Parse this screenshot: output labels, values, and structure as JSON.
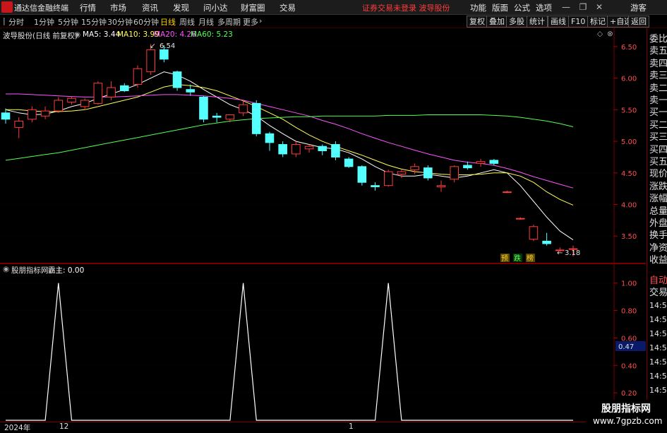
{
  "app": {
    "title": "通达信金融终端"
  },
  "menu": {
    "items": [
      "行情",
      "市场",
      "资讯",
      "发现",
      "问小达",
      "财富圈",
      "交易"
    ],
    "notice": "证券交易未登录  波导股份",
    "right_items": [
      "功能",
      "版面",
      "公式",
      "选项"
    ],
    "user": "游客",
    "r_badge": "R"
  },
  "toolbar": {
    "timeframes": [
      "分时",
      "1分钟",
      "5分钟",
      "15分钟",
      "30分钟",
      "60分钟",
      "日线",
      "周线",
      "月线",
      "多周期",
      "更多"
    ],
    "active": "日线",
    "right_buttons": [
      "复权",
      "叠加",
      "多股",
      "统计",
      "画线",
      "F10",
      "标记",
      "+自选",
      "返回"
    ]
  },
  "main_chart": {
    "stock_label": "波导股份(日线 前复权)",
    "ma": [
      {
        "label": "MA5: 3.44",
        "color": "#ffffff"
      },
      {
        "label": "MA10: 3.99",
        "color": "#ffff55"
      },
      {
        "label": "MA20: 4.26",
        "color": "#ff55ff"
      },
      {
        "label": "MA60: 5.23",
        "color": "#55ff55"
      }
    ],
    "high_label": "6.54",
    "low_label": "3.18",
    "signals": [
      "预",
      "跌",
      "榜"
    ],
    "y_ticks": [
      "6.50",
      "6.00",
      "5.50",
      "5.00",
      "4.50",
      "4.00",
      "3.50"
    ]
  },
  "sub_chart": {
    "indicator_label": "股朋指标网",
    "series_label": "霸主: 0.00",
    "y_ticks": [
      "1.00",
      "0.80",
      "0.60",
      "0.40",
      "0.20"
    ],
    "current_value": "0.47"
  },
  "right_panel": {
    "items": [
      "委比",
      "卖五",
      "卖四",
      "卖三",
      "卖二",
      "卖一",
      "买一",
      "买二",
      "买三",
      "买四",
      "买五",
      "现价",
      "涨跌",
      "涨幅",
      "总量",
      "外盘",
      "换手",
      "净资",
      "收益"
    ],
    "items2": [
      "自动",
      "交易"
    ],
    "times": [
      "14:56",
      "14:56",
      "14:56",
      "14:56",
      "14:56",
      "14:56",
      "14:56",
      "14:56"
    ]
  },
  "bottom": {
    "year": "2024年",
    "labels": [
      "12",
      "1"
    ]
  },
  "watermark": {
    "name": "股朋指标网",
    "url": "www.7gpzb.com"
  },
  "chart_data": {
    "type": "candlestick",
    "ylim": [
      3.1,
      6.7
    ],
    "candles": [
      [
        5.45,
        5.52,
        5.28,
        5.35
      ],
      [
        5.22,
        5.38,
        5.05,
        5.32
      ],
      [
        5.35,
        5.55,
        5.3,
        5.5
      ],
      [
        5.4,
        5.55,
        5.35,
        5.48
      ],
      [
        5.48,
        5.7,
        5.45,
        5.65
      ],
      [
        5.62,
        5.7,
        5.58,
        5.68
      ],
      [
        5.55,
        5.68,
        5.5,
        5.65
      ],
      [
        5.6,
        5.95,
        5.58,
        5.92
      ],
      [
        5.7,
        5.95,
        5.65,
        5.85
      ],
      [
        5.88,
        5.92,
        5.78,
        5.8
      ],
      [
        5.9,
        6.2,
        5.85,
        6.15
      ],
      [
        6.1,
        6.54,
        6.05,
        6.45
      ],
      [
        6.45,
        6.52,
        6.25,
        6.3
      ],
      [
        6.1,
        6.12,
        5.8,
        5.85
      ],
      [
        5.82,
        5.9,
        5.72,
        5.78
      ],
      [
        5.7,
        5.72,
        5.3,
        5.35
      ],
      [
        5.4,
        5.45,
        5.3,
        5.38
      ],
      [
        5.35,
        5.4,
        5.3,
        5.42
      ],
      [
        5.45,
        5.65,
        5.4,
        5.58
      ],
      [
        5.6,
        5.65,
        5.08,
        5.12
      ],
      [
        5.12,
        5.15,
        4.85,
        4.98
      ],
      [
        4.95,
        5.0,
        4.75,
        4.8
      ],
      [
        4.8,
        5.0,
        4.75,
        4.95
      ],
      [
        4.88,
        4.95,
        4.82,
        4.92
      ],
      [
        4.92,
        4.95,
        4.78,
        4.85
      ],
      [
        4.95,
        5.0,
        4.7,
        4.75
      ],
      [
        4.72,
        4.75,
        4.58,
        4.6
      ],
      [
        4.6,
        4.62,
        4.3,
        4.35
      ],
      [
        4.3,
        4.35,
        4.22,
        4.28
      ],
      [
        4.3,
        4.55,
        4.28,
        4.52
      ],
      [
        4.48,
        4.55,
        4.42,
        4.52
      ],
      [
        4.55,
        4.65,
        4.48,
        4.6
      ],
      [
        4.58,
        4.62,
        4.38,
        4.42
      ],
      [
        4.28,
        4.38,
        4.2,
        4.3
      ],
      [
        4.4,
        4.62,
        4.35,
        4.6
      ],
      [
        4.62,
        4.68,
        4.55,
        4.58
      ],
      [
        4.65,
        4.72,
        4.6,
        4.68
      ],
      [
        4.7,
        4.72,
        4.62,
        4.65
      ],
      [
        4.2,
        4.22,
        4.18,
        4.2
      ],
      [
        3.78,
        3.8,
        3.76,
        3.78
      ],
      [
        3.45,
        3.68,
        3.42,
        3.65
      ],
      [
        3.42,
        3.55,
        3.35,
        3.38
      ],
      [
        3.28,
        3.32,
        3.25,
        3.28
      ],
      [
        3.3,
        3.35,
        3.18,
        3.3
      ]
    ],
    "ma_series": [
      {
        "name": "MA5",
        "color": "#ffffff",
        "values": [
          5.5,
          5.45,
          5.42,
          5.43,
          5.48,
          5.55,
          5.6,
          5.68,
          5.75,
          5.82,
          5.9,
          6.0,
          6.1,
          6.05,
          5.95,
          5.82,
          5.7,
          5.58,
          5.5,
          5.4,
          5.25,
          5.12,
          5.0,
          4.95,
          4.9,
          4.88,
          4.82,
          4.72,
          4.6,
          4.5,
          4.45,
          4.45,
          4.48,
          4.45,
          4.42,
          4.45,
          4.5,
          4.55,
          4.5,
          4.3,
          4.05,
          3.8,
          3.58,
          3.44
        ]
      },
      {
        "name": "MA10",
        "color": "#ffff55",
        "values": [
          5.5,
          5.5,
          5.48,
          5.47,
          5.47,
          5.48,
          5.5,
          5.55,
          5.6,
          5.65,
          5.7,
          5.78,
          5.86,
          5.9,
          5.88,
          5.85,
          5.8,
          5.72,
          5.64,
          5.55,
          5.45,
          5.35,
          5.22,
          5.1,
          5.0,
          4.92,
          4.85,
          4.78,
          4.7,
          4.62,
          4.56,
          4.52,
          4.5,
          4.48,
          4.47,
          4.47,
          4.48,
          4.5,
          4.5,
          4.45,
          4.35,
          4.2,
          4.08,
          3.99
        ]
      },
      {
        "name": "MA20",
        "color": "#ff55ff",
        "values": [
          5.75,
          5.75,
          5.74,
          5.73,
          5.72,
          5.71,
          5.7,
          5.7,
          5.7,
          5.71,
          5.72,
          5.73,
          5.74,
          5.74,
          5.73,
          5.72,
          5.7,
          5.68,
          5.65,
          5.6,
          5.55,
          5.5,
          5.45,
          5.4,
          5.33,
          5.27,
          5.2,
          5.12,
          5.05,
          4.98,
          4.92,
          4.86,
          4.8,
          4.75,
          4.7,
          4.67,
          4.65,
          4.62,
          4.57,
          4.51,
          4.44,
          4.38,
          4.32,
          4.26
        ]
      },
      {
        "name": "MA60",
        "color": "#55ff55",
        "values": [
          4.7,
          4.73,
          4.76,
          4.79,
          4.82,
          4.86,
          4.9,
          4.94,
          4.98,
          5.02,
          5.06,
          5.1,
          5.14,
          5.18,
          5.22,
          5.26,
          5.29,
          5.32,
          5.34,
          5.36,
          5.37,
          5.38,
          5.39,
          5.39,
          5.4,
          5.4,
          5.4,
          5.4,
          5.4,
          5.41,
          5.41,
          5.41,
          5.42,
          5.42,
          5.42,
          5.42,
          5.42,
          5.41,
          5.4,
          5.38,
          5.35,
          5.32,
          5.28,
          5.23
        ]
      }
    ],
    "indicator": {
      "ylim": [
        0,
        1.05
      ],
      "peaks_at": [
        4,
        18,
        29
      ],
      "n": 44
    }
  }
}
